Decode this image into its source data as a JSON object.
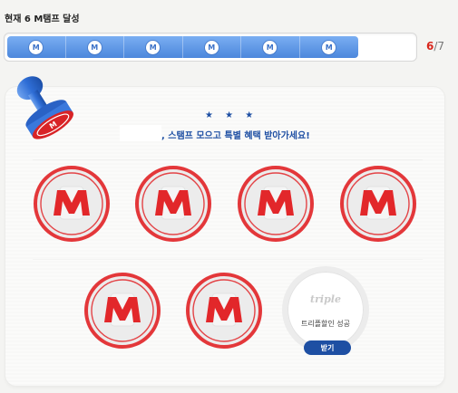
{
  "header": {
    "title": "현재 6 M탬프 달성"
  },
  "progress": {
    "current": "6",
    "separator": "/",
    "total": "7",
    "filled_segments": 6,
    "segment_icon": "m-brand-icon",
    "segment_icon_text": "M"
  },
  "banner": {
    "stars": "★ ★ ★",
    "headline": ", 스탬프 모으고 특별 혜택 받아가세요!"
  },
  "stamps": [
    {
      "state": "stamped",
      "icon": "red-m-stamp-icon"
    },
    {
      "state": "stamped",
      "icon": "red-m-stamp-icon"
    },
    {
      "state": "stamped",
      "icon": "red-m-stamp-icon"
    },
    {
      "state": "stamped",
      "icon": "red-m-stamp-icon"
    },
    {
      "state": "stamped",
      "icon": "red-m-stamp-icon"
    },
    {
      "state": "stamped",
      "icon": "red-m-stamp-icon"
    }
  ],
  "reward": {
    "brand": "triple",
    "label": "트리플할인 성공",
    "button_label": "받기"
  },
  "colors": {
    "accent_blue": "#1e4fa3",
    "progress_blue": "#4c87dc",
    "stamp_red": "#e2272a"
  }
}
